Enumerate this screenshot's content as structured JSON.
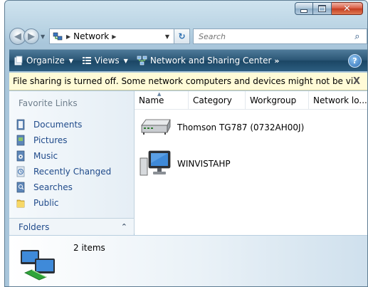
{
  "window": {
    "caption_buttons": [
      "minimize",
      "maximize",
      "close"
    ]
  },
  "address": {
    "location": "Network",
    "search_placeholder": "Search"
  },
  "toolbar": {
    "organize_label": "Organize",
    "views_label": "Views",
    "network_sharing_label": "Network and Sharing Center",
    "more_label": "»",
    "help_label": "?"
  },
  "infobar": {
    "message": "File sharing is turned off. Some network computers and devices might not be visible. ...",
    "close_label": "X"
  },
  "nav_pane": {
    "title": "Favorite Links",
    "items": [
      {
        "label": "Documents",
        "icon": "documents-icon"
      },
      {
        "label": "Pictures",
        "icon": "pictures-icon"
      },
      {
        "label": "Music",
        "icon": "music-icon"
      },
      {
        "label": "Recently Changed",
        "icon": "recently-changed-icon"
      },
      {
        "label": "Searches",
        "icon": "searches-icon"
      },
      {
        "label": "Public",
        "icon": "public-folder-icon"
      }
    ],
    "folders_label": "Folders",
    "folders_chevron": "⌃"
  },
  "columns": [
    "Name",
    "Category",
    "Workgroup",
    "Network lo..."
  ],
  "items": [
    {
      "label": "Thomson TG787 (0732AH00J)",
      "icon": "router-icon"
    },
    {
      "label": "WINVISTAHP",
      "icon": "computer-icon"
    }
  ],
  "details": {
    "count": "2 items",
    "icon": "network-icon"
  },
  "colors": {
    "toolbar": "#2b5675",
    "infobar": "#fffbd7",
    "link": "#1f4a8a"
  }
}
